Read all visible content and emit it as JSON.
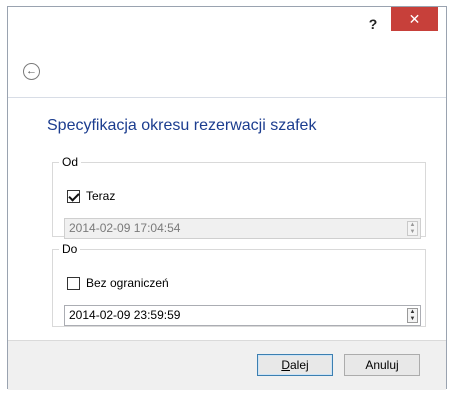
{
  "titlebar": {
    "help_label": "?",
    "close_label": "✕"
  },
  "nav": {
    "back_icon": "back-arrow-icon",
    "back_glyph": "←"
  },
  "page": {
    "title": "Specyfikacja okresu rezerwacji szafek"
  },
  "from_group": {
    "legend": "Od",
    "now_checkbox_label": "Teraz",
    "now_checked": true,
    "datetime_value": "2014-02-09 17:04:54",
    "datetime_disabled": true
  },
  "to_group": {
    "legend": "Do",
    "unlimited_checkbox_label": "Bez ograniczeń",
    "unlimited_checked": false,
    "datetime_value": "2014-02-09 23:59:59",
    "datetime_disabled": false
  },
  "footer": {
    "next_label_mnemonic": "D",
    "next_label_rest": "alej",
    "cancel_label": "Anuluj"
  },
  "spinner": {
    "up_glyph": "▲",
    "down_glyph": "▼"
  }
}
